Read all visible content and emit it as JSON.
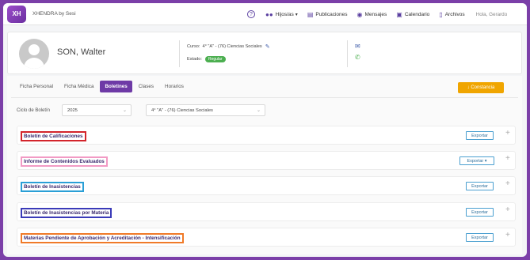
{
  "app": {
    "logo_text": "XH",
    "title": "XHENDRA by Sesi"
  },
  "nav": {
    "help": "?",
    "items": [
      {
        "label": "Hijos/as",
        "icon": "users-icon",
        "glyph": "👥",
        "chevron": "▾"
      },
      {
        "label": "Publicaciones",
        "icon": "publications-icon",
        "glyph": "▬",
        "chevron": ""
      },
      {
        "label": "Mensajes",
        "icon": "messages-icon",
        "glyph": "💬",
        "chevron": ""
      },
      {
        "label": "Calendario",
        "icon": "calendar-icon",
        "glyph": "▭",
        "chevron": ""
      },
      {
        "label": "Archivos",
        "icon": "files-icon",
        "glyph": "▯",
        "chevron": ""
      }
    ],
    "greeting": "Hola, Gerardo"
  },
  "student": {
    "name": "SON, Walter",
    "course_label": "Curso:",
    "course_value": "4° \"A\" - (76) Ciencias Sociales",
    "status_label": "Estado:",
    "status_value": "Regular",
    "status_color": "#4caf50"
  },
  "tabs": [
    {
      "label": "Ficha Personal",
      "active": false
    },
    {
      "label": "Ficha Médica",
      "active": false
    },
    {
      "label": "Boletines",
      "active": true
    },
    {
      "label": "Clases",
      "active": false
    },
    {
      "label": "Horarios",
      "active": false
    }
  ],
  "constancia_button": "↓ Constancia",
  "filters": {
    "cycle_label": "Ciclo de Boletín",
    "year_value": "2025",
    "course_value": "4° \"A\" - (76) Ciencias Sociales"
  },
  "sections": [
    {
      "title": "Boletín de Calificaciones",
      "export": "Exportar",
      "highlight": "#d3242b"
    },
    {
      "title": "Informe de Contenidos Evaluados",
      "export": "Exportar ▾",
      "highlight": "#f29ac4"
    },
    {
      "title": "Boletín de Inasistencias",
      "export": "Exportar",
      "highlight": "#2a9fd6"
    },
    {
      "title": "Boletín de Inasistencias por Materia",
      "export": "Exportar",
      "highlight": "#3a3ab8"
    },
    {
      "title": "Materias Pendiente de Aprobación y Acreditación - Intensificación",
      "export": "Exportar",
      "highlight": "#f07a28"
    }
  ],
  "colors": {
    "frame": "#7b3fa8",
    "accent": "#6e3aa6",
    "constancia": "#f0a500"
  }
}
